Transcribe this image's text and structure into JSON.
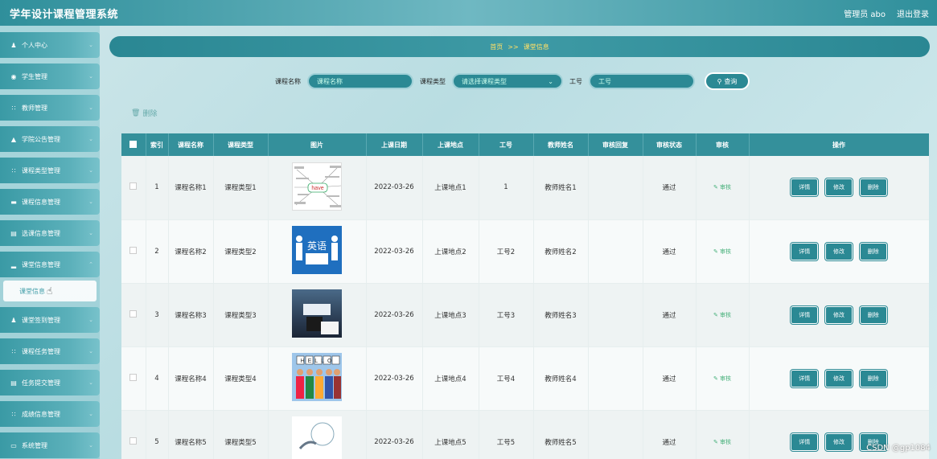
{
  "app": {
    "title": "学年设计课程管理系统"
  },
  "topbar": {
    "user": "管理员 abo",
    "logout": "退出登录"
  },
  "sidebar": {
    "items": [
      {
        "label": "个人中心",
        "icon": "user-icon"
      },
      {
        "label": "学生管理",
        "icon": "pin-icon"
      },
      {
        "label": "教师管理",
        "icon": "grid-icon"
      },
      {
        "label": "学院公告管理",
        "icon": "bank-icon"
      },
      {
        "label": "课程类型管理",
        "icon": "grid-icon"
      },
      {
        "label": "课程信息管理",
        "icon": "card-icon"
      },
      {
        "label": "选课信息管理",
        "icon": "doc-icon"
      },
      {
        "label": "课堂信息管理",
        "icon": "bar-chart-icon"
      },
      {
        "label": "课堂签到管理",
        "icon": "user-icon"
      },
      {
        "label": "课程任务管理",
        "icon": "grid-icon"
      },
      {
        "label": "任务提交管理",
        "icon": "doc-icon"
      },
      {
        "label": "成绩信息管理",
        "icon": "grid-icon"
      },
      {
        "label": "系统管理",
        "icon": "monitor-icon"
      }
    ],
    "submenu": {
      "label": "课堂信息"
    }
  },
  "breadcrumb": {
    "home": "首页",
    "sep": ">>",
    "current": "课堂信息"
  },
  "search": {
    "course_name_label": "课程名称",
    "course_name_placeholder": "课程名称",
    "course_type_label": "课程类型",
    "course_type_placeholder": "请选择课程类型",
    "job_no_label": "工号",
    "job_no_placeholder": "工号",
    "query_button": "查询"
  },
  "toolbar": {
    "delete_label": "删除"
  },
  "table": {
    "headers": [
      "索引",
      "课程名称",
      "课程类型",
      "图片",
      "上课日期",
      "上课地点",
      "工号",
      "教师姓名",
      "审核回复",
      "审核状态",
      "审核",
      "操作"
    ],
    "rows": [
      {
        "index": "1",
        "course_name": "课程名称1",
        "course_type": "课程类型1",
        "date": "2022-03-26",
        "place": "上课地点1",
        "job_no": "1",
        "teacher": "教师姓名1",
        "reply": "",
        "status": "通过",
        "review": "审核",
        "thumb_caption": "have"
      },
      {
        "index": "2",
        "course_name": "课程名称2",
        "course_type": "课程类型2",
        "date": "2022-03-26",
        "place": "上课地点2",
        "job_no": "工号2",
        "teacher": "教师姓名2",
        "reply": "",
        "status": "通过",
        "review": "审核",
        "thumb_caption": "英语"
      },
      {
        "index": "3",
        "course_name": "课程名称3",
        "course_type": "课程类型3",
        "date": "2022-03-26",
        "place": "上课地点3",
        "job_no": "工号3",
        "teacher": "教师姓名3",
        "reply": "",
        "status": "通过",
        "review": "审核",
        "thumb_caption": ""
      },
      {
        "index": "4",
        "course_name": "课程名称4",
        "course_type": "课程类型4",
        "date": "2022-03-26",
        "place": "上课地点4",
        "job_no": "工号4",
        "teacher": "教师姓名4",
        "reply": "",
        "status": "通过",
        "review": "审核",
        "thumb_caption": "HELLO"
      },
      {
        "index": "5",
        "course_name": "课程名称5",
        "course_type": "课程类型5",
        "date": "2022-03-26",
        "place": "上课地点5",
        "job_no": "工号5",
        "teacher": "教师姓名5",
        "reply": "",
        "status": "通过",
        "review": "审核",
        "thumb_caption": ""
      }
    ],
    "actions": {
      "detail": "详情",
      "edit": "修改",
      "delete": "删除"
    }
  },
  "watermark": "CSDN @gp1084",
  "colors": {
    "primary": "#2b8994",
    "accent": "#ffe066",
    "review": "#46b07a"
  }
}
